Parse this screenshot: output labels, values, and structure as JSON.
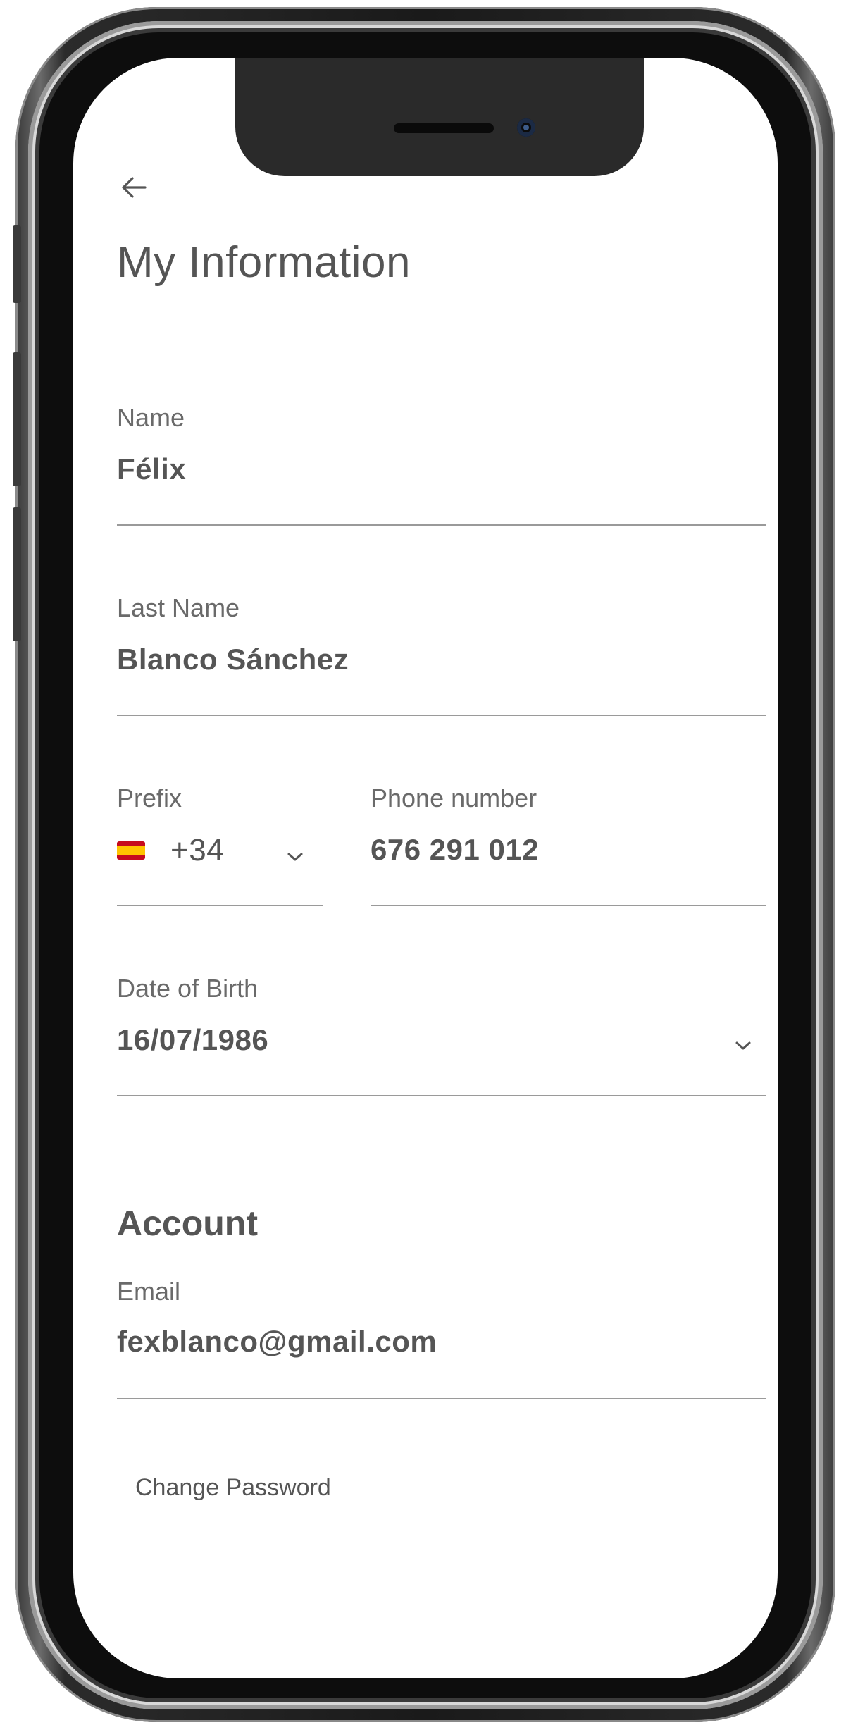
{
  "header": {
    "back_icon": "arrow-left-icon",
    "title": "My Information"
  },
  "personal": {
    "name": {
      "label": "Name",
      "value": "Félix"
    },
    "last_name": {
      "label": "Last Name",
      "value": "Blanco Sánchez"
    },
    "prefix": {
      "label": "Prefix",
      "value": "+34",
      "flag_icon": "spain-flag-icon"
    },
    "phone": {
      "label": "Phone number",
      "value": "676 291 012"
    },
    "dob": {
      "label": "Date of Birth",
      "value": "16/07/1986"
    }
  },
  "account": {
    "heading": "Account",
    "email": {
      "label": "Email",
      "value": "fexblanco@gmail.com"
    },
    "change_password": "Change Password"
  },
  "colors": {
    "text_primary": "#555555",
    "label": "#6a6a6a",
    "divider": "#9a9a9a",
    "flag_red": "#c60b1e",
    "flag_yellow": "#ffc400"
  }
}
